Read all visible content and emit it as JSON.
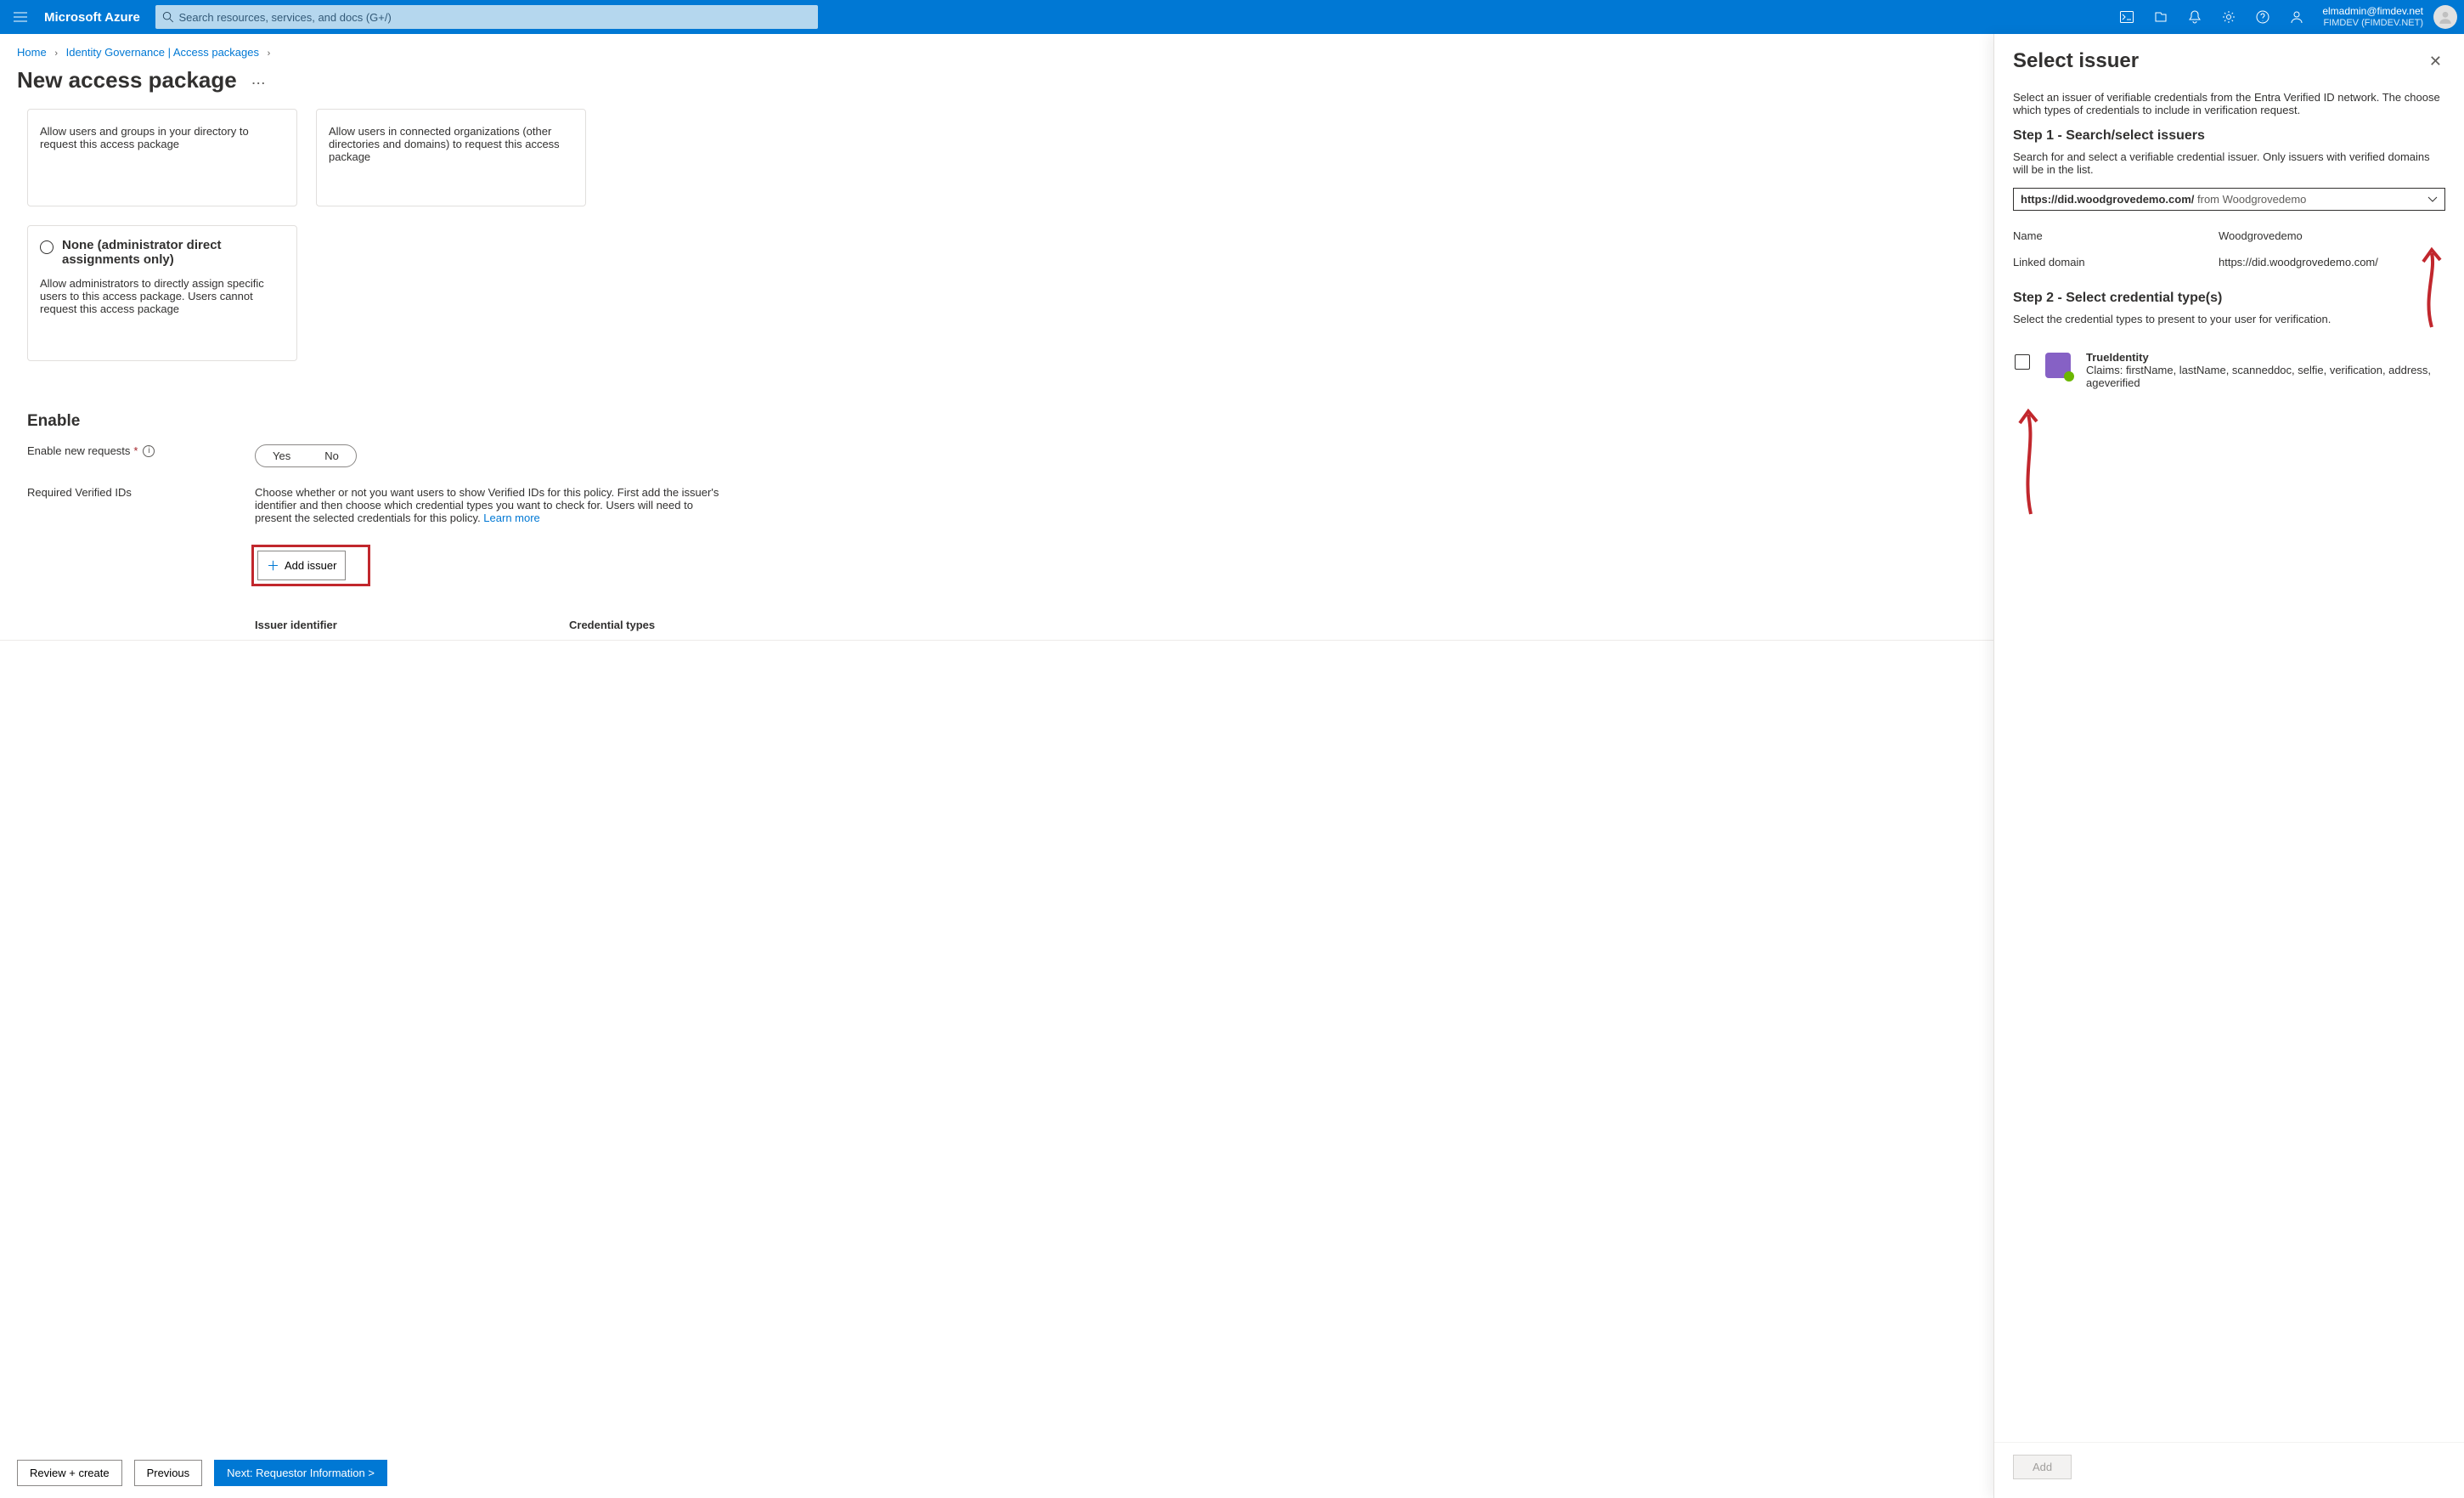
{
  "topbar": {
    "brand": "Microsoft Azure",
    "search_placeholder": "Search resources, services, and docs (G+/)",
    "account_email": "elmadmin@fimdev.net",
    "account_tenant": "FIMDEV (FIMDEV.NET)"
  },
  "breadcrumb": {
    "home": "Home",
    "governance": "Identity Governance | Access packages"
  },
  "page": {
    "title": "New access package",
    "more": "..."
  },
  "cards": {
    "c1": "Allow users and groups in your directory to request this access package",
    "c2": "Allow users in connected organizations (other directories and domains) to request this access package",
    "c3_title": "None (administrator direct assignments only)",
    "c3_desc": "Allow administrators to directly assign specific users to this access package. Users cannot request this access package"
  },
  "enable": {
    "heading": "Enable",
    "new_req_label": "Enable new requests",
    "yes": "Yes",
    "no": "No",
    "verified_label": "Required Verified IDs",
    "verified_desc": "Choose whether or not you want users to show Verified IDs for this policy. First add the issuer's identifier and then choose which credential types you want to check for. Users will need to present the selected credentials for this policy. ",
    "learn_more": "Learn more",
    "add_issuer": "Add issuer",
    "col1": "Issuer identifier",
    "col2": "Credential types"
  },
  "footer": {
    "review": "Review + create",
    "previous": "Previous",
    "next": "Next: Requestor Information >"
  },
  "panel": {
    "title": "Select issuer",
    "intro": "Select an issuer of verifiable credentials from the Entra Verified ID network. The choose which types of credentials to include in verification request.",
    "step1_h": "Step 1 - Search/select issuers",
    "step1_p": "Search for and select a verifiable credential issuer. Only issuers with verified domains will be in the list.",
    "combo_domain": "https://did.woodgrovedemo.com/",
    "combo_from": "from",
    "combo_org": "Woodgrovedemo",
    "name_k": "Name",
    "name_v": "Woodgrovedemo",
    "ld_k": "Linked domain",
    "ld_v": "https://did.woodgrovedemo.com/",
    "step2_h": "Step 2 - Select credential type(s)",
    "step2_p": "Select the credential types to present to your user for verification.",
    "cred_title": "TrueIdentity",
    "cred_claims": "Claims: firstName, lastName, scanneddoc, selfie, verification, address, ageverified",
    "add": "Add"
  }
}
